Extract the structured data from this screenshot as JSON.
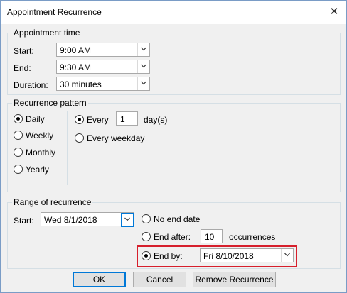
{
  "window": {
    "title": "Appointment Recurrence",
    "close_glyph": "✕"
  },
  "appointment_time": {
    "legend": "Appointment time",
    "start_label": "Start:",
    "start_value": "9:00 AM",
    "end_label": "End:",
    "end_value": "9:30 AM",
    "duration_label": "Duration:",
    "duration_value": "30 minutes"
  },
  "recurrence_pattern": {
    "legend": "Recurrence pattern",
    "options": {
      "daily": "Daily",
      "weekly": "Weekly",
      "monthly": "Monthly",
      "yearly": "Yearly"
    },
    "selected": "Daily",
    "every_label": "Every",
    "every_value": "1",
    "every_unit": "day(s)",
    "every_weekday_label": "Every weekday"
  },
  "range": {
    "legend": "Range of recurrence",
    "start_label": "Start:",
    "start_value": "Wed 8/1/2018",
    "no_end_label": "No end date",
    "end_after_label": "End after:",
    "end_after_value": "10",
    "occurrences_label": "occurrences",
    "end_by_label": "End by:",
    "end_by_value": "Fri 8/10/2018",
    "selected": "End by:"
  },
  "buttons": {
    "ok": "OK",
    "cancel": "Cancel",
    "remove": "Remove Recurrence"
  },
  "colors": {
    "highlight": "#d61f2c",
    "accent": "#0078d7"
  }
}
